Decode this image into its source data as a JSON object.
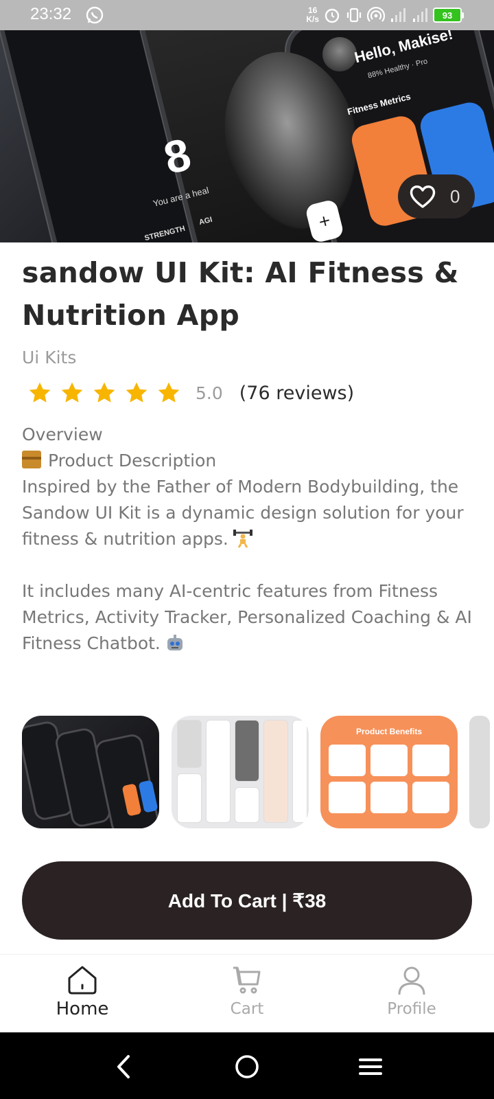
{
  "status_bar": {
    "time": "23:32",
    "net_speed_value": "16",
    "net_speed_unit": "K/s",
    "battery": "93",
    "left_icon": "whatsapp-icon",
    "right_icons": [
      "alarm-icon",
      "vibrate-icon",
      "hotspot-icon",
      "signal-4g-icon",
      "signal-4g-icon",
      "battery-icon"
    ]
  },
  "hero": {
    "phone_number": "8",
    "phone_caption": "You are a heal",
    "tag_strength": "STRENGTH",
    "tag_agi": "AGI",
    "greeting": "Hello, Makise!",
    "greeting_sub": "88% Healthy · Pro",
    "metrics_label": "Fitness Metrics",
    "favorite_count": "0"
  },
  "product": {
    "title": "sandow UI Kit: AI Fitness & Nutrition App",
    "category": "Ui Kits",
    "rating": "5.0",
    "stars": 5,
    "reviews": "(76 reviews)",
    "overview_heading": "Overview",
    "description_heading": "Product Description",
    "paragraph_1": "Inspired by the Father of Modern Bodybuilding, the Sandow UI Kit is a dynamic design solution for your fitness & nutrition apps.",
    "paragraph_2": "It includes many AI-centric features from Fitness Metrics, Activity Tracker, Personalized Coaching & AI Fitness Chatbot."
  },
  "gallery": {
    "benefits_title": "Product Benefits"
  },
  "cta": {
    "label": "Add To Cart | ₹38"
  },
  "bottom_nav": {
    "items": [
      {
        "label": "Home",
        "icon": "home-icon",
        "active": true
      },
      {
        "label": "Cart",
        "icon": "cart-icon",
        "active": false
      },
      {
        "label": "Profile",
        "icon": "profile-icon",
        "active": false
      }
    ]
  },
  "colors": {
    "status_bar": "#b9b9b9",
    "cta_background": "#2b2323",
    "star": "#f7b500",
    "muted_text": "#777777",
    "accent_orange": "#f27f3a"
  }
}
